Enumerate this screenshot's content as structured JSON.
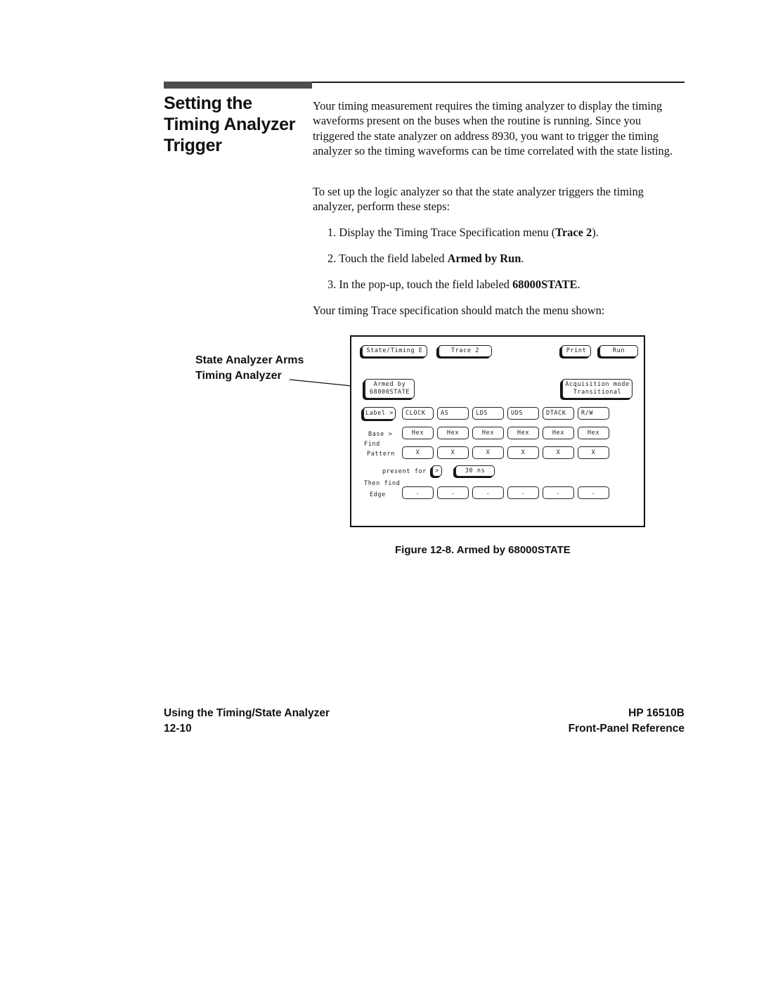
{
  "section": {
    "heading_lines": [
      "Setting the",
      "Timing Analyzer",
      "Trigger"
    ]
  },
  "body": {
    "paragraph1": "Your timing measurement requires the timing analyzer to display the timing waveforms present on the buses when the routine is running.  Since you triggered the state analyzer on address 8930, you want to trigger the timing analyzer so the timing waveforms can be time correlated with the state listing.",
    "paragraph2": "To set up the logic analyzer so that the state analyzer triggers the timing analyzer, perform these steps:",
    "steps": [
      {
        "prefix": "1. Display the Timing Trace Specification menu (",
        "bold": "Trace 2",
        "suffix": ")."
      },
      {
        "prefix": "2. Touch the field labeled ",
        "bold": "Armed by Run",
        "suffix": "."
      },
      {
        "prefix": "3. In the pop-up, touch the field labeled ",
        "bold": "68000STATE",
        "suffix": "."
      }
    ],
    "paragraph3": "Your timing Trace specification should match the menu shown:"
  },
  "callout": {
    "line1": "State Analyzer Arms",
    "line2": "Timing Analyzer"
  },
  "menu": {
    "top_buttons": {
      "module": "State/Timing E",
      "trace": "Trace 2",
      "print": "Print",
      "run": "Run"
    },
    "armed_by": {
      "line1": "Armed by",
      "line2": "68000STATE"
    },
    "acquisition": {
      "line1": "Acquisition mode",
      "line2": "Transitional"
    },
    "label_button": "Label >",
    "labels": [
      "CLOCK",
      "AS",
      "LDS",
      "UDS",
      "DTACK",
      "R/W"
    ],
    "base_label": "Base >",
    "bases": [
      "Hex",
      "Hex",
      "Hex",
      "Hex",
      "Hex",
      "Hex"
    ],
    "find_label": "Find",
    "pattern_label": "Pattern",
    "patterns": [
      "X",
      "X",
      "X",
      "X",
      "X",
      "X"
    ],
    "present_for_label": "present for",
    "present_for_op": ">",
    "present_for_value": "30 ns",
    "then_find_label": "Then find",
    "edge_label": "Edge",
    "edges": [
      ".",
      ".",
      ".",
      ".",
      ".",
      "."
    ]
  },
  "figure": {
    "caption": "Figure 12-8. Armed by 68000STATE"
  },
  "footer": {
    "left_title": "Using the Timing/State Analyzer",
    "page_number": "12-10",
    "product": "HP 16510B",
    "manual": "Front-Panel Reference"
  }
}
